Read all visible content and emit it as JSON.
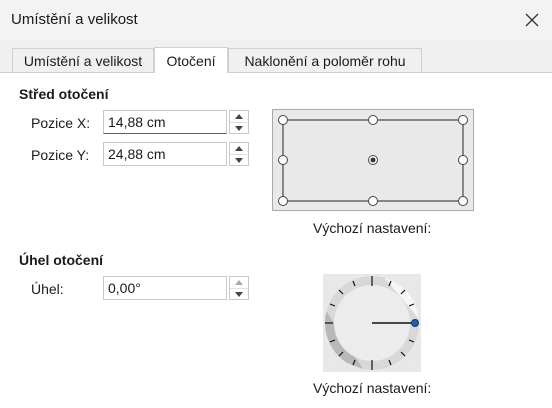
{
  "window": {
    "title": "Umístění a velikost"
  },
  "tabs": [
    {
      "label": "Umístění a velikost",
      "active": false
    },
    {
      "label": "Otočení",
      "active": true
    },
    {
      "label": "Naklonění a poloměr rohu",
      "active": false
    }
  ],
  "pivot": {
    "heading": "Střed otočení",
    "x_label": "Pozice X:",
    "x_value": "14,88 cm",
    "y_label": "Pozice Y:",
    "y_value": "24,88 cm",
    "preview_caption": "Výchozí nastavení:"
  },
  "angle": {
    "heading": "Úhel otočení",
    "label": "Úhel:",
    "value": "0,00°",
    "dial_caption": "Výchozí nastavení:"
  },
  "colors": {
    "accent": "#2a6fc0",
    "dial_handle": "#1e5ea8"
  },
  "icons": {
    "close": "close-icon",
    "spin_up": "chevron-up-icon",
    "spin_down": "chevron-down-icon"
  }
}
